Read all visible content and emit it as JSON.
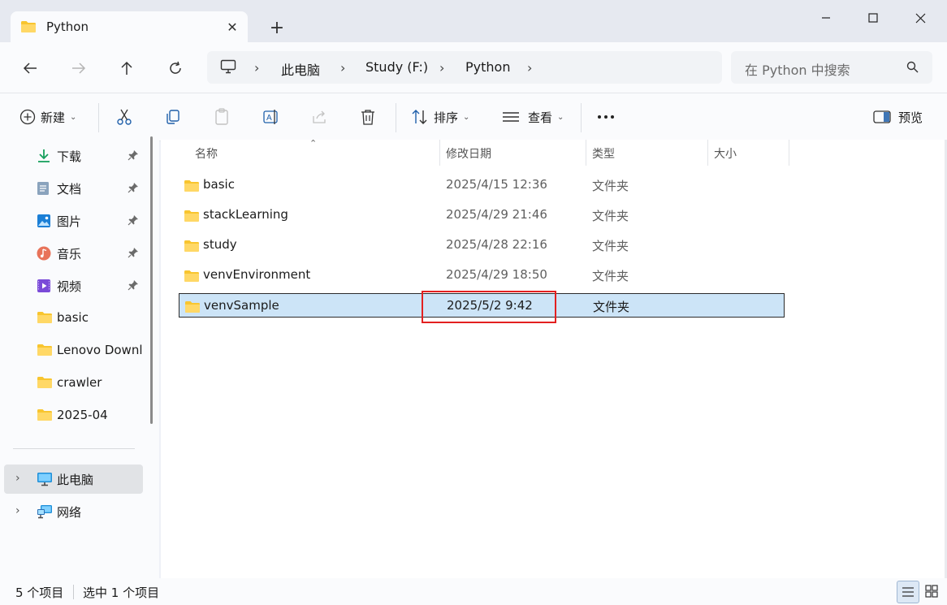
{
  "tab": {
    "title": "Python"
  },
  "address": {
    "crumbs": [
      "此电脑",
      "Study (F:)",
      "Python"
    ]
  },
  "search": {
    "placeholder": "在 Python 中搜索"
  },
  "toolbar": {
    "new_label": "新建",
    "sort_label": "排序",
    "view_label": "查看",
    "preview_label": "预览"
  },
  "nav": {
    "quick_access": [
      {
        "label": "下载",
        "icon": "download-icon",
        "pinned": true
      },
      {
        "label": "文档",
        "icon": "document-icon",
        "pinned": true
      },
      {
        "label": "图片",
        "icon": "pictures-icon",
        "pinned": true
      },
      {
        "label": "音乐",
        "icon": "music-icon",
        "pinned": true
      },
      {
        "label": "视频",
        "icon": "video-icon",
        "pinned": true
      },
      {
        "label": "basic",
        "icon": "folder-icon",
        "pinned": false
      },
      {
        "label": "Lenovo Downloads",
        "icon": "folder-icon",
        "pinned": false
      },
      {
        "label": "crawler",
        "icon": "folder-icon",
        "pinned": false
      },
      {
        "label": "2025-04",
        "icon": "folder-icon",
        "pinned": false
      }
    ],
    "this_pc": "此电脑",
    "network": "网络"
  },
  "columns": {
    "name": "名称",
    "date": "修改日期",
    "type": "类型",
    "size": "大小"
  },
  "files": [
    {
      "name": "basic",
      "date": "2025/4/15 12:36",
      "type": "文件夹"
    },
    {
      "name": "stackLearning",
      "date": "2025/4/29 21:46",
      "type": "文件夹"
    },
    {
      "name": "study",
      "date": "2025/4/28 22:16",
      "type": "文件夹"
    },
    {
      "name": "venvEnvironment",
      "date": "2025/4/29 18:50",
      "type": "文件夹"
    },
    {
      "name": "venvSample",
      "date": "2025/5/2 9:42",
      "type": "文件夹",
      "selected": true
    }
  ],
  "status": {
    "count": "5 个项目",
    "selected": "选中 1 个项目"
  },
  "colors": {
    "accent": "#0067c0",
    "selection": "#cce4f7",
    "annotation_box": "#e32020",
    "folder": "#f8c52f"
  }
}
